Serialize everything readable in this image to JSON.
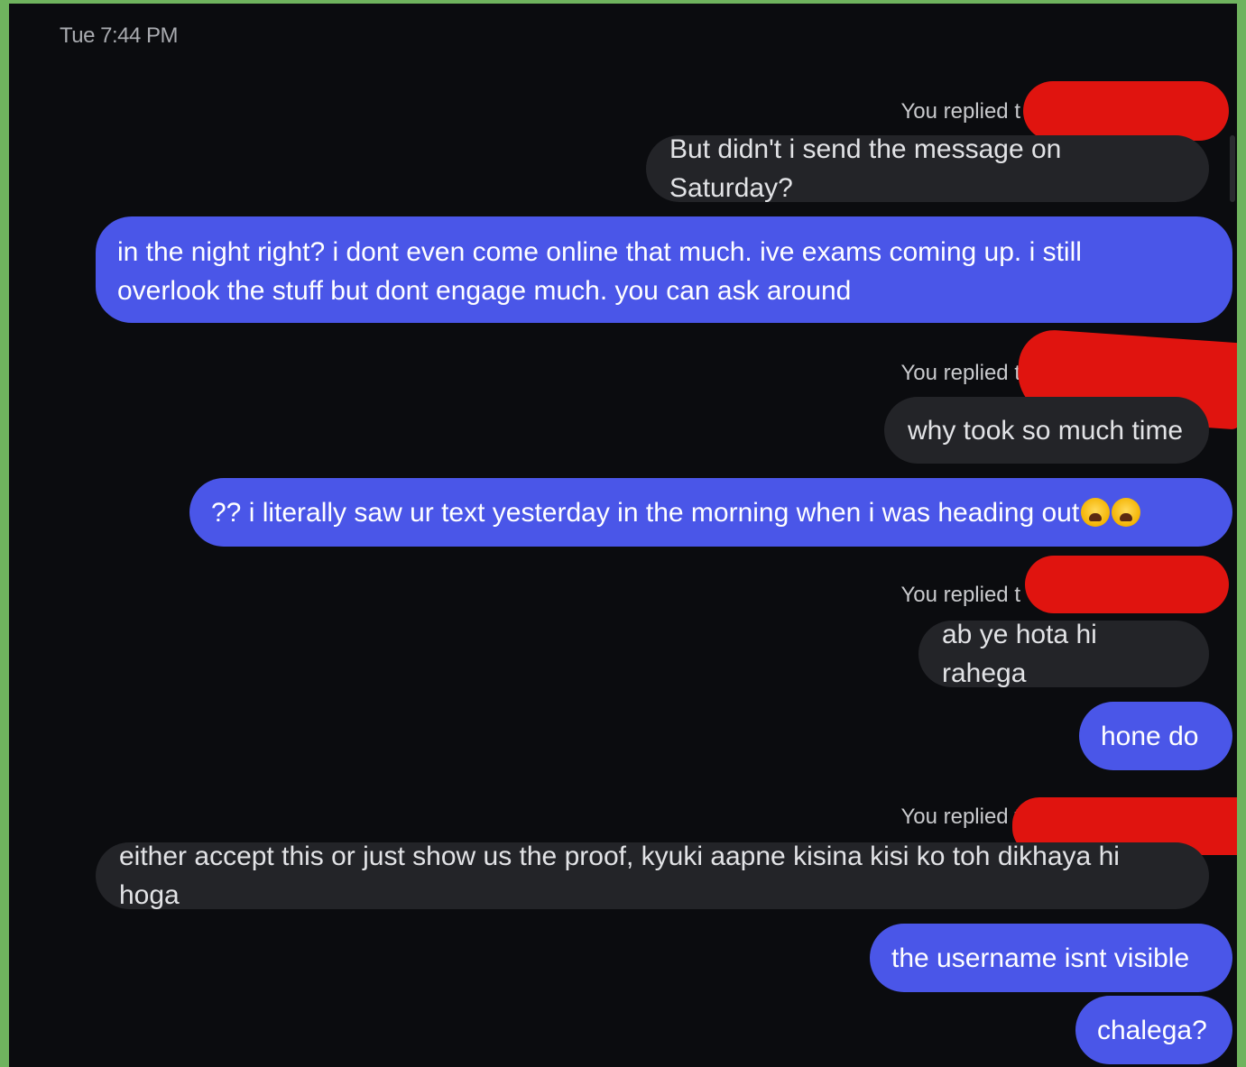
{
  "header": {
    "timestamp": "Tue 7:44 PM"
  },
  "messages": {
    "r1": {
      "label": "You replied t",
      "text": "But didn't i send the message on Saturday?"
    },
    "m1": {
      "line1": "in the night right? i dont even come online that much. ive exams coming up. i still",
      "line2": "overlook the stuff but dont engage much. you can ask around"
    },
    "r2": {
      "label": "You replied t",
      "text": "why took so much time"
    },
    "m2": {
      "text": "?? i literally saw ur text yesterday in the morning when i was heading out"
    },
    "r3": {
      "label": "You replied t",
      "text": "ab ye hota hi rahega"
    },
    "m3": {
      "text": "hone do"
    },
    "r4": {
      "label": "You replied t",
      "text": "either accept this or just show us the proof, kyuki aapne kisina kisi ko toh dikhaya hi hoga"
    },
    "m4": {
      "text": "the username isnt visible"
    },
    "m5": {
      "text": "chalega?"
    }
  },
  "colors": {
    "background": "#0b0c0f",
    "sent_bubble": "#4a56e8",
    "received_bubble": "#232428",
    "redaction": "#e0140f",
    "border": "#6fb35e"
  },
  "icons": [
    "crying-face-emoji",
    "crying-face-emoji"
  ]
}
